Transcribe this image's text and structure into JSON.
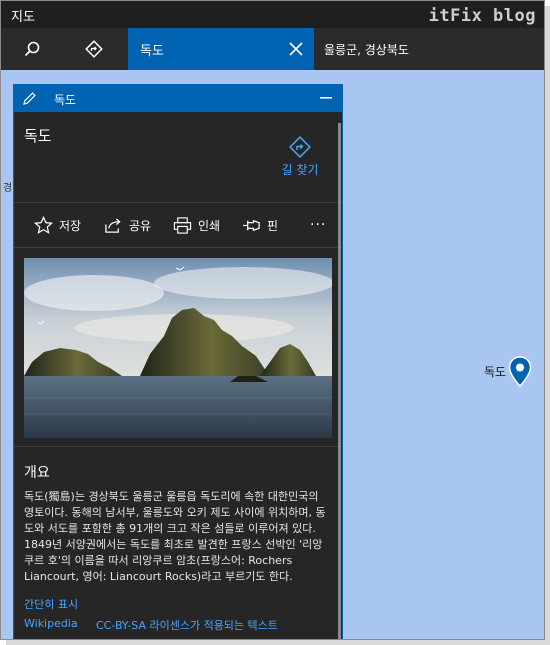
{
  "app": {
    "title": "지도",
    "watermark": "itFix blog"
  },
  "toolbar": {
    "search_value": "독도",
    "location": "울릉군, 경상북도"
  },
  "map": {
    "left_label": "경",
    "pin_label": "독도",
    "colors": {
      "water": "#a9c6f2",
      "pin": "#0063b1"
    }
  },
  "panel": {
    "header_title": "독도",
    "place_name": "독도",
    "directions_label": "길 찾기",
    "actions": {
      "save": "저장",
      "share": "공유",
      "print": "인쇄",
      "pin": "핀",
      "more": "···"
    },
    "overview_heading": "개요",
    "overview_text": "독도(獨島)는 경상북도 울릉군 울릉읍 독도리에 속한 대한민국의 영토이다. 동해의 남서부, 울릉도와 오키 제도 사이에 위치하며, 동도와 서도를 포함한 총 91개의 크고 작은 섬들로 이루어져 있다. 1849년 서양권에서는 독도를 최초로 발견한 프랑스 선박인 '리앙쿠르 호'의 이름을 따서 리앙쿠르 암초(프랑스어: Rochers Liancourt, 영어: Liancourt Rocks)라고 부르기도 한다.",
    "show_less": "간단히 표시",
    "source": "Wikipedia",
    "license": "CC-BY-SA 라이센스가 적용되는 텍스트"
  },
  "icons": {
    "search": "search-icon",
    "directions": "directions-icon",
    "close": "close-icon",
    "edit": "edit-icon",
    "minimize": "minimize-icon",
    "save": "star-icon",
    "share": "share-icon",
    "print": "printer-icon",
    "pin": "pin-icon",
    "more": "more-icon",
    "map_pin": "map-pin-icon"
  },
  "colors": {
    "accent": "#0063b1",
    "link": "#4aa3ff",
    "panel_bg": "#262626"
  }
}
